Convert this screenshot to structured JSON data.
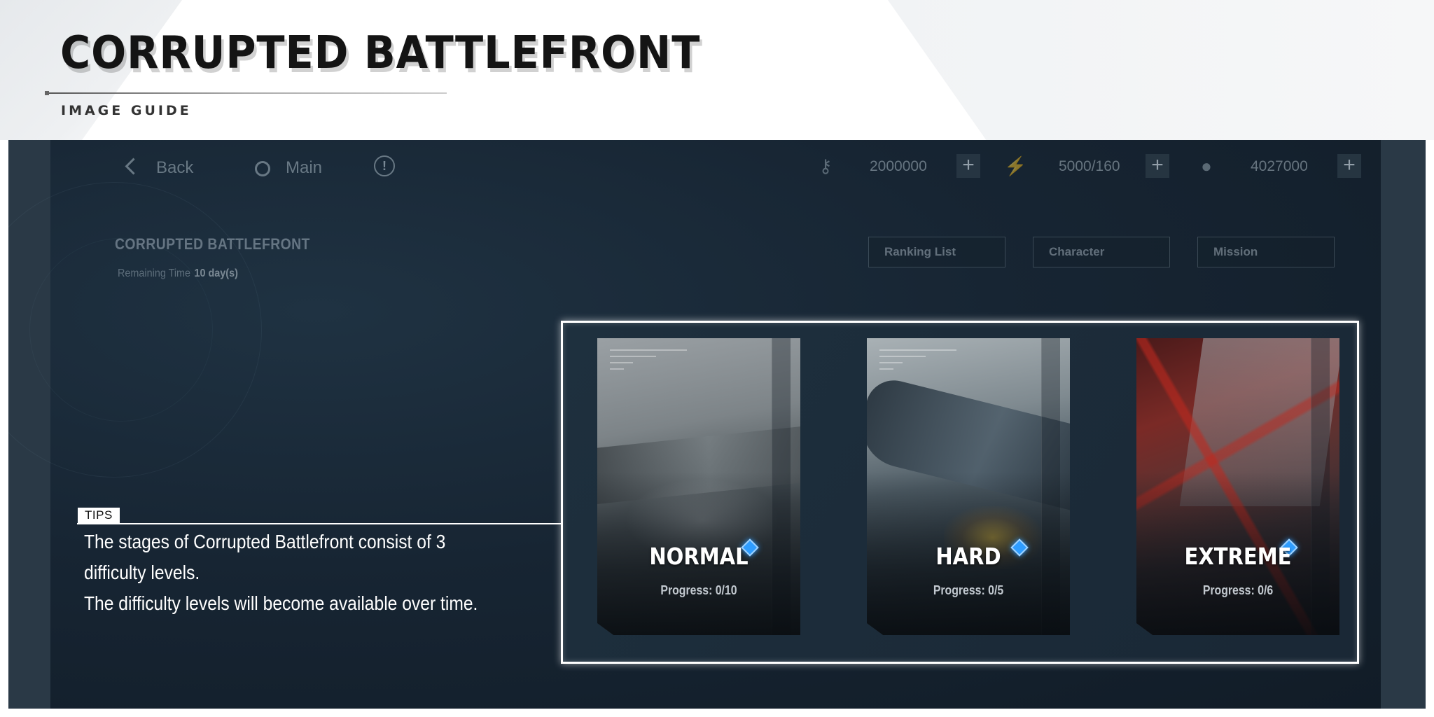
{
  "guide": {
    "title": "CORRUPTED BATTLEFRONT",
    "subtitle": "IMAGE GUIDE"
  },
  "topbar": {
    "back_label": "Back",
    "main_label": "Main",
    "info_glyph": "!",
    "resources": [
      {
        "icon": "key-icon",
        "value": "2000000"
      },
      {
        "icon": "battery-icon",
        "value": "5000/160"
      },
      {
        "icon": "coin-icon",
        "value": "4027000"
      }
    ],
    "plus_glyph": "+"
  },
  "event": {
    "title": "CORRUPTED BATTLEFRONT",
    "remaining_label": "Remaining Time",
    "remaining_value": "10 day(s)"
  },
  "tabs": [
    "Ranking List",
    "Character",
    "Mission"
  ],
  "difficulties": [
    {
      "name": "NORMAL",
      "progress": "Progress: 0/10"
    },
    {
      "name": "HARD",
      "progress": "Progress: 0/5"
    },
    {
      "name": "EXTREME",
      "progress": "Progress: 0/6"
    }
  ],
  "tips": {
    "tag": "TIPS",
    "lines": [
      "The stages of Corrupted Battlefront consist of 3",
      "difficulty levels.",
      "The difficulty levels will become available over time."
    ]
  },
  "colors": {
    "highlight_border": "#ffffff",
    "diamond": "#2f9dff",
    "screen_bg": "#172533"
  }
}
